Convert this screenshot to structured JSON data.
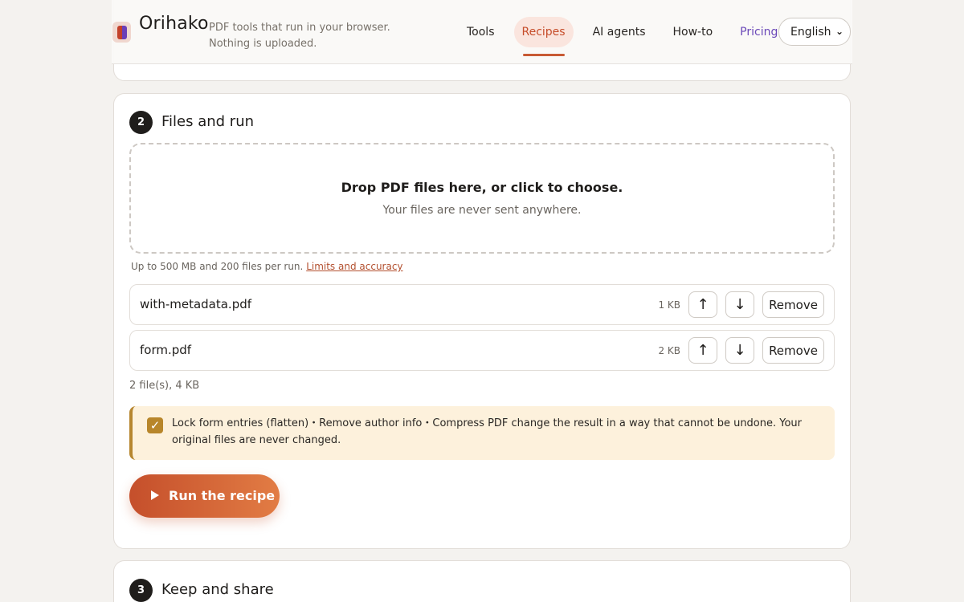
{
  "header": {
    "brand": "Orihako",
    "tagline": "PDF tools that run in your browser. Nothing is uploaded.",
    "nav": [
      "Tools",
      "Recipes",
      "AI agents",
      "How-to",
      "Pricing"
    ],
    "language": "English",
    "accent_color": "#c85a34"
  },
  "files_section": {
    "step": "2",
    "title": "Files and run",
    "dropzone": {
      "title": "Drop PDF files here, or click to choose.",
      "subtitle": "Your files are never sent anywhere."
    },
    "limits_text": "Up to 500 MB and 200 files per run.",
    "limits_link": "Limits and accuracy",
    "files": [
      {
        "name": "with-metadata.pdf",
        "size": "1 KB",
        "up_icon": "↑",
        "down_icon": "↓",
        "remove": "Remove"
      },
      {
        "name": "form.pdf",
        "size": "2 KB",
        "up_icon": "↑",
        "down_icon": "↓",
        "remove": "Remove"
      }
    ],
    "summary": "2 file(s), 4 KB",
    "warning": {
      "checked": true,
      "text": "Lock form entries (flatten)・Remove author info・Compress PDF change the result in a way that cannot be undone. Your original files are never changed."
    },
    "run_label": "Run the recipe"
  },
  "keep_section": {
    "step": "3",
    "title": "Keep and share"
  }
}
